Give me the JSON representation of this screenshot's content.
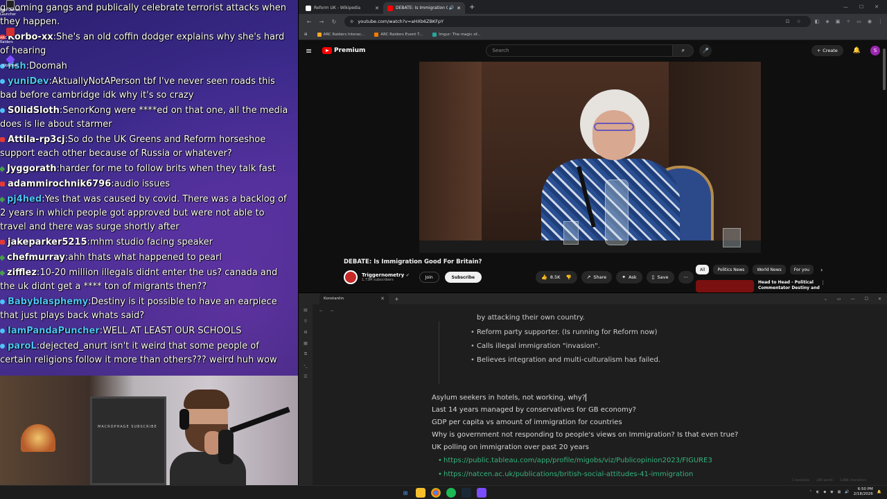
{
  "chat": {
    "messages": [
      {
        "user": "",
        "text": "grooming gangs and publically celebrate terrorist attacks when they happen.",
        "color": "#ffffff",
        "badge": "none"
      },
      {
        "user": "Korbo-xx",
        "text": "She's an old coffin dodger explains why she's hard of hearing",
        "color": "#ffffff",
        "badge": "red"
      },
      {
        "user": "fish",
        "text": "Doomah",
        "color": "#4fc3f7",
        "badge": "blue"
      },
      {
        "user": "yuniDev",
        "text": "AktuallyNotAPerson tbf I've never seen roads this bad before cambridge  idk why it's so crazy",
        "color": "#4fc3f7",
        "badge": "blue"
      },
      {
        "user": "S0lidSloth",
        "text": "SenorKong were ****ed on that one, all the media does is lie about starmer",
        "color": "#ffffff",
        "badge": "blue"
      },
      {
        "user": "Attila-rp3cj",
        "text": "So do the UK Greens and Reform horseshoe support each other because of Russia or whatever?",
        "color": "#ffffff",
        "badge": "red"
      },
      {
        "user": "Jyggorath",
        "text": "harder for me to follow brits when they talk fast",
        "color": "#ffffff",
        "badge": "green"
      },
      {
        "user": "adammirochnik6796",
        "text": "audio issues",
        "color": "#ffffff",
        "badge": "red"
      },
      {
        "user": "pj4hed",
        "text": "Yes that was caused by covid. There was a backlog of 2 years in which people got approved but were not able to travel and there was surge shortly after",
        "color": "#4fc3f7",
        "badge": "green"
      },
      {
        "user": "jakeparker5215",
        "text": "mhm studio facing speaker",
        "color": "#ffffff",
        "badge": "red"
      },
      {
        "user": "chefmurray",
        "text": "ahh thats what happened to pearl",
        "color": "#ffffff",
        "badge": "green"
      },
      {
        "user": "zifflez",
        "text": "10-20 million illegals didnt enter the us? canada and the uk didnt get a **** ton of migrants then??",
        "color": "#ffffff",
        "badge": "green"
      },
      {
        "user": "Babyblasphemy",
        "text": "Destiny is it possible to have an earpiece that just plays back whats said?",
        "color": "#4fc3f7",
        "badge": "blue"
      },
      {
        "user": "IamPandaPuncher",
        "text": "WELL AT LEAST OUR SCHOOLS",
        "color": "#4fc3f7",
        "badge": "blue"
      },
      {
        "user": "paroL",
        "text": "dejected_anurt isn't it weird that some people of certain religions follow it more than others??? weird huh wow",
        "color": "#4fc3f7",
        "badge": "blue"
      }
    ],
    "desktop_icons": [
      "Epic Games Launcher",
      "ARC Raiders",
      "Obsidian"
    ]
  },
  "webcam": {
    "poster_text": "MACROPHAGE SUBSCRIBE"
  },
  "browser": {
    "tabs": [
      {
        "label": "Reform UK - Wikipedia",
        "active": false,
        "fav_color": "#ffffff"
      },
      {
        "label": "DEBATE: Is Immigration Go...",
        "active": true,
        "fav_color": "#ff0000"
      }
    ],
    "url": "youtube.com/watch?v=aHXb6ZBKFpY",
    "bookmarks": [
      "ARC Raiders Interac...",
      "ARC Raiders Event T...",
      "Imgur: The magic of..."
    ]
  },
  "youtube": {
    "brand": "Premium",
    "search_placeholder": "Search",
    "create_label": "Create",
    "avatar_letter": "S",
    "video_title": "DEBATE: Is Immigration Good For Britain?",
    "channel_name": "Triggernometry",
    "channel_subs": "1.73M subscribers",
    "join_label": "Join",
    "subscribe_label": "Subscribe",
    "likes": "8.5K",
    "share_label": "Share",
    "ask_label": "Ask",
    "save_label": "Save",
    "chips": [
      "All",
      "Politics News",
      "World News",
      "For you"
    ],
    "rec_title": "Head to Head - Political Commentator Destiny and"
  },
  "notes": {
    "tab_label": "Konstantin",
    "bullets": [
      "by attacking their own country.",
      "Reform party supporter. (Is running for Reform now)",
      "Calls illegal immigration \"invasion\".",
      "Believes integration and multi-culturalism has failed."
    ],
    "lines": [
      "Asylum seekers in hotels, not working, why?",
      "Last 14 years managed by conservatives for GB economy?",
      "GDP per capita vs amount of immigration for countries",
      "Why is government not responding to people's views on Immigration? Is that even true?",
      "UK polling on immigration over past 20 years"
    ],
    "links": [
      "https://public.tableau.com/app/profile/migobs/viz/Publicopinion2023/FIGURE3",
      "https://natcen.ac.uk/publications/british-social-attitudes-41-immigration"
    ],
    "status": [
      "1 backlinks",
      "296 words",
      "1,886 characters"
    ]
  },
  "taskbar": {
    "time": "6:50 PM",
    "date": "2/18/2026"
  }
}
